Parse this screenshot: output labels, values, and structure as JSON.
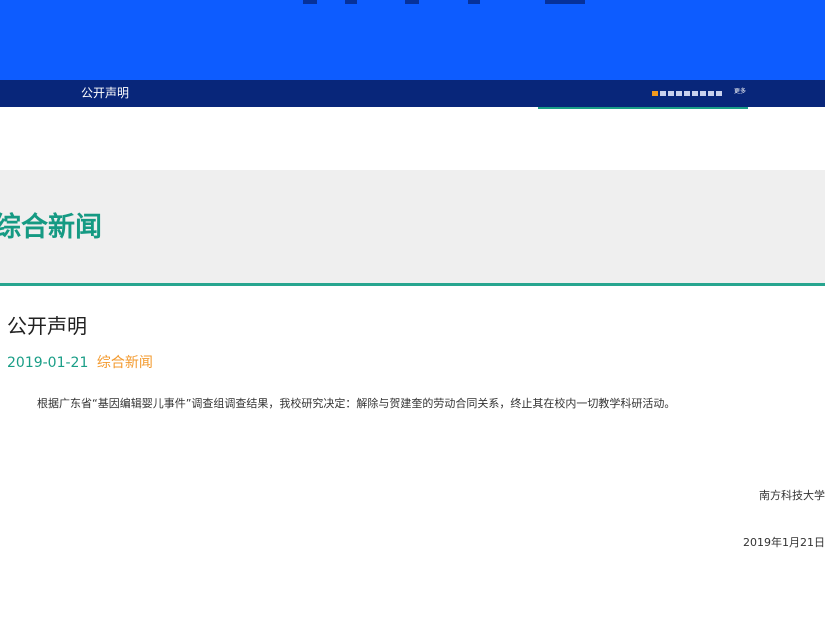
{
  "nav": {
    "breadcrumb": "公开声明",
    "more_label": "更多",
    "pager_dots_total": 9,
    "pager_dots_active_index": 0
  },
  "section": {
    "title": "综合新闻"
  },
  "article": {
    "title": "公开声明",
    "date": "2019-01-21",
    "category": "综合新闻",
    "body": "根据广东省“基因编辑婴儿事件”调查组调查结果，我校研究决定：解除与贺建奎的劳动合同关系，终止其在校内一切教学科研活动。",
    "signature_org": "南方科技大学",
    "signature_date": "2019年1月21日"
  },
  "colors": {
    "banner_blue": "#0d5cff",
    "nav_navy": "#08267a",
    "accent_teal": "#159a83",
    "accent_orange": "#f39a2e",
    "band_gray": "#efefef"
  }
}
